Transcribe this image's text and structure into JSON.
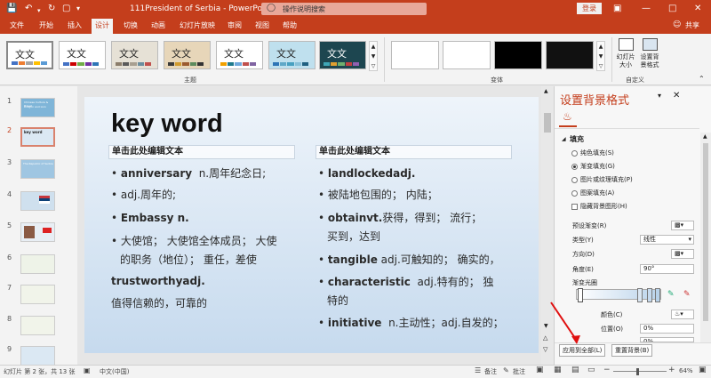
{
  "window": {
    "title": "111President of Serbia  -  PowerPoint",
    "search_placeholder": "操作说明搜索",
    "login": "登录"
  },
  "tabs": [
    "文件",
    "开始",
    "插入",
    "设计",
    "切换",
    "动画",
    "幻灯片放映",
    "审阅",
    "视图",
    "帮助"
  ],
  "active_tab": "设计",
  "share": "共享",
  "ribbon": {
    "themes_group": "主题",
    "variants_group": "变体",
    "customize_group": "自定义",
    "theme_sample": "文文",
    "slide_size": "幻灯片大小",
    "format_bg": "设置背景格式"
  },
  "thumbnails": {
    "numbers": [
      "1",
      "2",
      "3",
      "4",
      "5",
      "6",
      "7",
      "8",
      "9"
    ],
    "t1_line1": "Chinese Culture & Travel",
    "t1_line2": "Dragon and Lion",
    "t2_title": "key word",
    "t3_title": "The Republic of Serbia"
  },
  "slide": {
    "title": "key  word",
    "left_heading": "单击此处编辑文本",
    "right_heading": "单击此处编辑文本",
    "left": {
      "b1_word": "anniversary",
      "b1_rest": "n.周年纪念日;",
      "b2": "adj.周年的;",
      "b3": "Embassy n.",
      "b4_line1": "大使馆；  大使馆全体成员；  大使",
      "b4_line2": "的职务（地位）；  重任，差使",
      "plain_word": "trustworthyadj.",
      "plain_cn": "值得信赖的，可靠的"
    },
    "right": {
      "b1": "landlockedadj.",
      "b2": "被陆地包围的；  内陆；",
      "b3_word": "obtainvt.",
      "b3_rest": "获得，得到；  流行；",
      "b3_line2": "买到，达到",
      "b4_word": "tangible",
      "b4_rest": "adj.可触知的；  确实的，",
      "b5_word": "characteristic",
      "b5_rest": "adj.特有的；  独",
      "b5_line2": "特的",
      "b6_word": "initiative",
      "b6_rest": "n.主动性；adj.自发的；"
    }
  },
  "pane": {
    "title": "设置背景格式",
    "section": "填充",
    "options": [
      "纯色填充(S)",
      "渐变填充(G)",
      "图片或纹理填充(P)",
      "图案填充(A)"
    ],
    "hide_bg": "隐藏背景图形(H)",
    "preset": "预设渐变(R)",
    "type_label": "类型(Y)",
    "type_value": "线性",
    "direction": "方向(D)",
    "angle_label": "角度(E)",
    "angle_value": "90°",
    "stops_label": "渐变光圈",
    "color_label": "颜色(C)",
    "position_label": "位置(O)",
    "position_value": "0%",
    "transparency_value": "0%",
    "apply_all": "应用到全部(L)",
    "reset": "重置背景(B)"
  },
  "status": {
    "slide_info": "幻灯片 第 2 张，共 13 张",
    "language": "中文(中国)",
    "notes": "备注",
    "comments": "批注",
    "zoom": "64%"
  },
  "colors": {
    "accent": "#c43e1c"
  }
}
